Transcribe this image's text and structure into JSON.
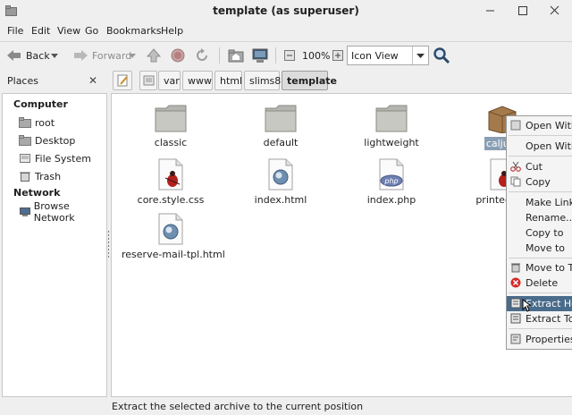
{
  "window": {
    "title": "template (as superuser)"
  },
  "menu": [
    "File",
    "Edit",
    "View",
    "Go",
    "Bookmarks",
    "Help"
  ],
  "toolbar": {
    "back": "Back",
    "forward": "Forward",
    "zoom": "100%",
    "view_mode": "Icon View"
  },
  "places": {
    "header": "Places",
    "sections": [
      {
        "title": "Computer",
        "items": [
          "root",
          "Desktop",
          "File System",
          "Trash"
        ]
      },
      {
        "title": "Network",
        "items": [
          "Browse Network"
        ]
      }
    ]
  },
  "path": [
    "var",
    "www",
    "html",
    "slims8",
    "template"
  ],
  "files": [
    {
      "name": "classic",
      "kind": "folder"
    },
    {
      "name": "default",
      "kind": "folder"
    },
    {
      "name": "lightweight",
      "kind": "folder"
    },
    {
      "name": "calju...",
      "kind": "archive",
      "selected": true
    },
    {
      "name": "core.style.css",
      "kind": "css"
    },
    {
      "name": "index.html",
      "kind": "html"
    },
    {
      "name": "index.php",
      "kind": "php"
    },
    {
      "name": "printed.s...",
      "kind": "css"
    },
    {
      "name": "reserve-mail-tpl.html",
      "kind": "html"
    }
  ],
  "context_menu": [
    "Open With A",
    "Open With O",
    "Cut",
    "Copy",
    "Make Link",
    "Rename...",
    "Copy to",
    "Move to",
    "Move to Tra",
    "Delete",
    "Extract Here",
    "Extract To...",
    "Properties"
  ],
  "status": "Extract the selected archive to the current position"
}
